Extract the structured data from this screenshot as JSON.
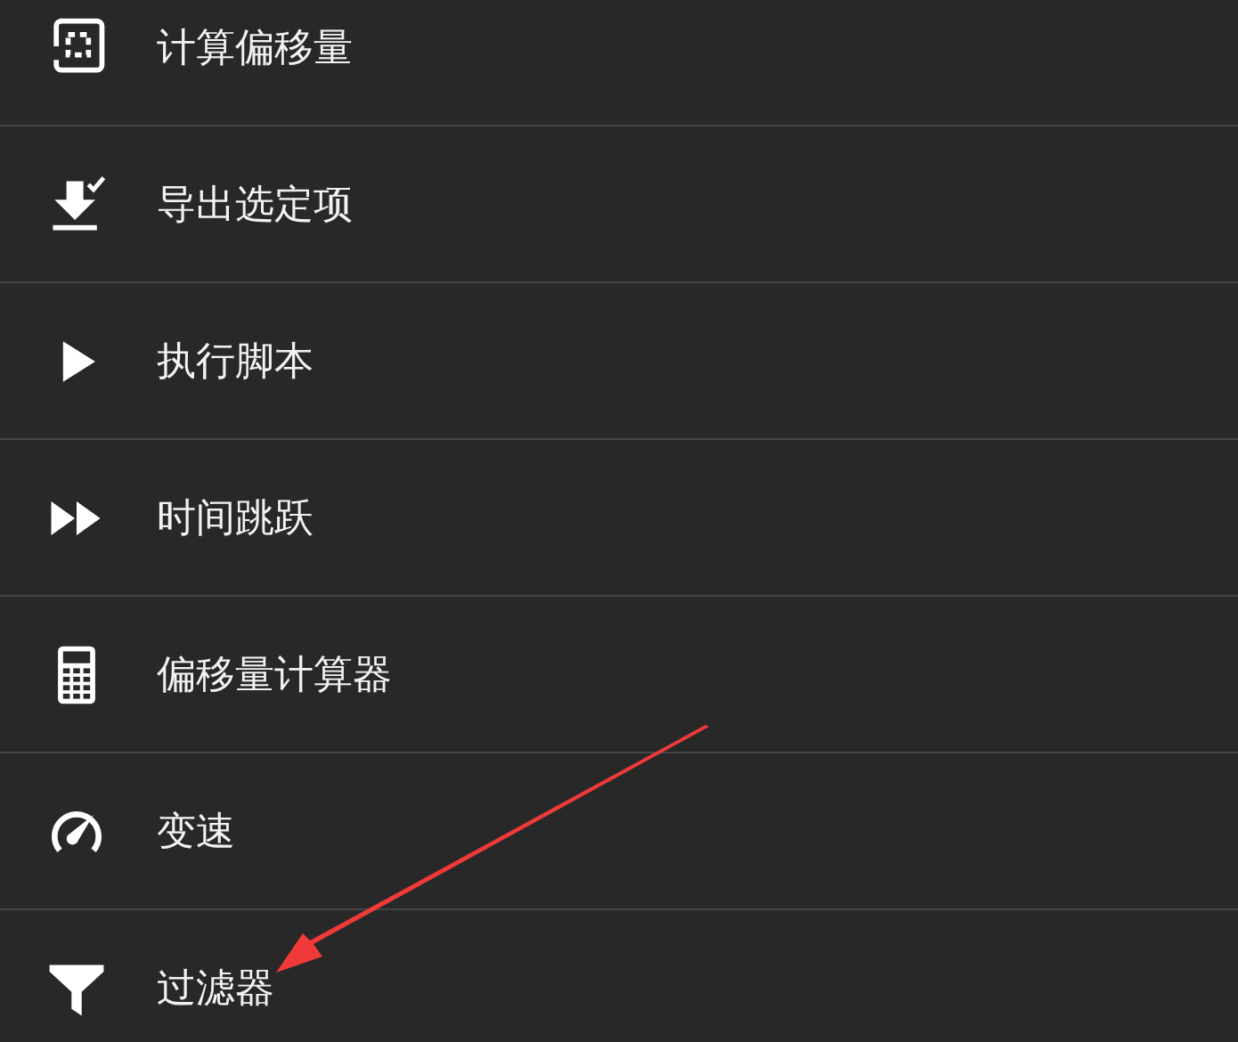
{
  "menu": {
    "items": [
      {
        "label": "计算偏移量"
      },
      {
        "label": "导出选定项"
      },
      {
        "label": "执行脚本"
      },
      {
        "label": "时间跳跃"
      },
      {
        "label": "偏移量计算器"
      },
      {
        "label": "变速"
      },
      {
        "label": "过滤器"
      }
    ]
  }
}
